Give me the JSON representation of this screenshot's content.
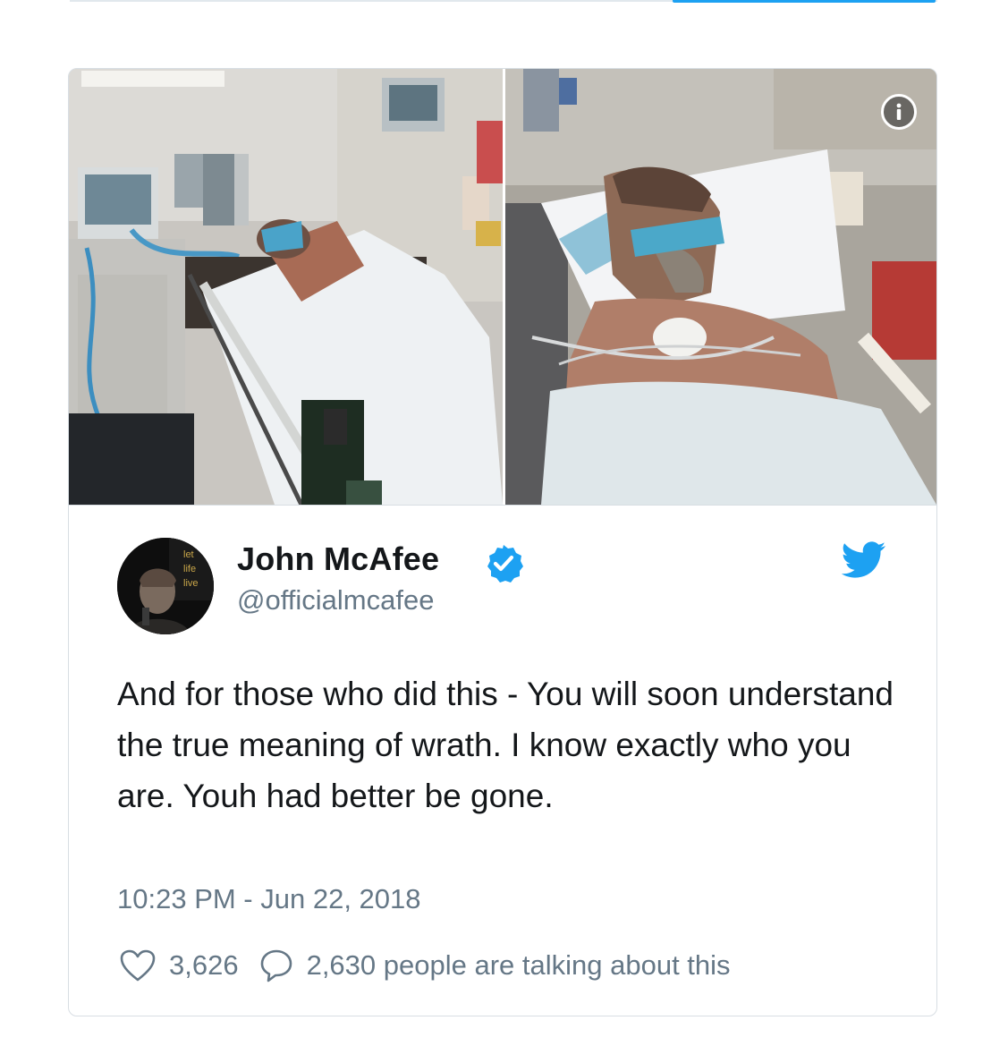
{
  "tweet": {
    "author_name": "John McAfee",
    "author_handle": "@officialmcafee",
    "verified": true,
    "text": "And for those who did this - You will soon understand the true meaning of wrath. I know exactly who you  are. Youh had better be gone.",
    "timestamp": "10:23 PM - Jun 22, 2018",
    "likes": "3,626",
    "talking": "2,630 people are talking about this"
  },
  "avatar": {
    "overlay_lines": [
      "let",
      "life",
      "live"
    ]
  },
  "media": {
    "photo_count": 2,
    "info_icon": "info-icon"
  },
  "icons": {
    "verified": "verified-badge-icon",
    "brand": "twitter-bird-icon",
    "like": "heart-icon",
    "reply": "speech-bubble-icon"
  },
  "colors": {
    "brand_blue": "#1da1f2",
    "text_primary": "#14171a",
    "text_secondary": "#657786",
    "border": "#d8dee3"
  }
}
